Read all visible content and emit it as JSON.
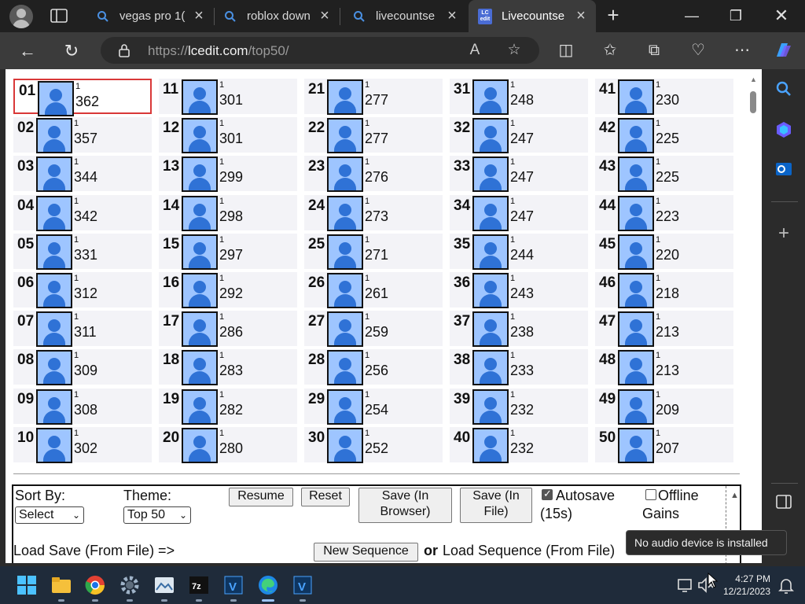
{
  "tabs": [
    {
      "label": "vegas pro 1("
    },
    {
      "label": "roblox down"
    },
    {
      "label": "livecountse"
    },
    {
      "label": "Livecountse"
    }
  ],
  "address": {
    "scheme": "https://",
    "host": "lcedit.com",
    "path": "/top50/"
  },
  "ranks": [
    {
      "rank": "01",
      "sub": "1",
      "count": "362"
    },
    {
      "rank": "02",
      "sub": "1",
      "count": "357"
    },
    {
      "rank": "03",
      "sub": "1",
      "count": "344"
    },
    {
      "rank": "04",
      "sub": "1",
      "count": "342"
    },
    {
      "rank": "05",
      "sub": "1",
      "count": "331"
    },
    {
      "rank": "06",
      "sub": "1",
      "count": "312"
    },
    {
      "rank": "07",
      "sub": "1",
      "count": "311"
    },
    {
      "rank": "08",
      "sub": "1",
      "count": "309"
    },
    {
      "rank": "09",
      "sub": "1",
      "count": "308"
    },
    {
      "rank": "10",
      "sub": "1",
      "count": "302"
    },
    {
      "rank": "11",
      "sub": "1",
      "count": "301"
    },
    {
      "rank": "12",
      "sub": "1",
      "count": "301"
    },
    {
      "rank": "13",
      "sub": "1",
      "count": "299"
    },
    {
      "rank": "14",
      "sub": "1",
      "count": "298"
    },
    {
      "rank": "15",
      "sub": "1",
      "count": "297"
    },
    {
      "rank": "16",
      "sub": "1",
      "count": "292"
    },
    {
      "rank": "17",
      "sub": "1",
      "count": "286"
    },
    {
      "rank": "18",
      "sub": "1",
      "count": "283"
    },
    {
      "rank": "19",
      "sub": "1",
      "count": "282"
    },
    {
      "rank": "20",
      "sub": "1",
      "count": "280"
    },
    {
      "rank": "21",
      "sub": "1",
      "count": "277"
    },
    {
      "rank": "22",
      "sub": "1",
      "count": "277"
    },
    {
      "rank": "23",
      "sub": "1",
      "count": "276"
    },
    {
      "rank": "24",
      "sub": "1",
      "count": "273"
    },
    {
      "rank": "25",
      "sub": "1",
      "count": "271"
    },
    {
      "rank": "26",
      "sub": "1",
      "count": "261"
    },
    {
      "rank": "27",
      "sub": "1",
      "count": "259"
    },
    {
      "rank": "28",
      "sub": "1",
      "count": "256"
    },
    {
      "rank": "29",
      "sub": "1",
      "count": "254"
    },
    {
      "rank": "30",
      "sub": "1",
      "count": "252"
    },
    {
      "rank": "31",
      "sub": "1",
      "count": "248"
    },
    {
      "rank": "32",
      "sub": "1",
      "count": "247"
    },
    {
      "rank": "33",
      "sub": "1",
      "count": "247"
    },
    {
      "rank": "34",
      "sub": "1",
      "count": "247"
    },
    {
      "rank": "35",
      "sub": "1",
      "count": "244"
    },
    {
      "rank": "36",
      "sub": "1",
      "count": "243"
    },
    {
      "rank": "37",
      "sub": "1",
      "count": "238"
    },
    {
      "rank": "38",
      "sub": "1",
      "count": "233"
    },
    {
      "rank": "39",
      "sub": "1",
      "count": "232"
    },
    {
      "rank": "40",
      "sub": "1",
      "count": "232"
    },
    {
      "rank": "41",
      "sub": "1",
      "count": "230"
    },
    {
      "rank": "42",
      "sub": "1",
      "count": "225"
    },
    {
      "rank": "43",
      "sub": "1",
      "count": "225"
    },
    {
      "rank": "44",
      "sub": "1",
      "count": "223"
    },
    {
      "rank": "45",
      "sub": "1",
      "count": "220"
    },
    {
      "rank": "46",
      "sub": "1",
      "count": "218"
    },
    {
      "rank": "47",
      "sub": "1",
      "count": "213"
    },
    {
      "rank": "48",
      "sub": "1",
      "count": "213"
    },
    {
      "rank": "49",
      "sub": "1",
      "count": "209"
    },
    {
      "rank": "50",
      "sub": "1",
      "count": "207"
    }
  ],
  "controls": {
    "sort_label": "Sort By:",
    "sort_value": "Select",
    "theme_label": "Theme:",
    "theme_value": "Top 50",
    "resume": "Resume",
    "reset": "Reset",
    "save_browser_1": "Save (In",
    "save_browser_2": "Browser)",
    "save_file_1": "Save (In",
    "save_file_2": "File)",
    "autosave_1": "Autosave",
    "autosave_2": "(15s)",
    "autosave_checked": true,
    "offline_1": "Offline",
    "offline_2": "Gains",
    "offline_checked": false,
    "load_save": "Load Save (From File) =>",
    "new_sequence": "New Sequence",
    "or": "or",
    "load_sequence": "Load Sequence (From File)"
  },
  "tooltip": "No audio device is installed",
  "clock": {
    "time": "4:27 PM",
    "date": "12/21/2023"
  },
  "colors": {
    "highlight": "#d93838",
    "avatar_bg": "#9ec5ff",
    "avatar_fg": "#2f72d6"
  }
}
